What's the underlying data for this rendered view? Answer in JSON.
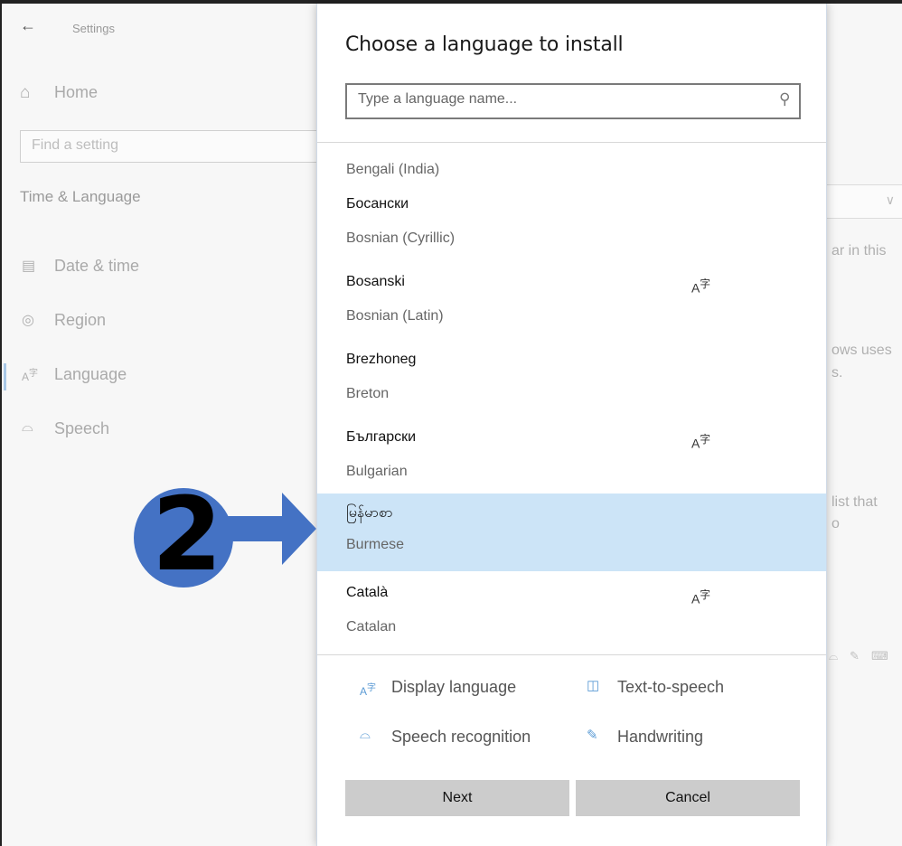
{
  "settings": {
    "title": "Settings",
    "home_label": "Home",
    "search_placeholder": "Find a setting",
    "section_title": "Time & Language",
    "nav": [
      {
        "label": "Date & time",
        "icon": "calendar-clock-icon"
      },
      {
        "label": "Region",
        "icon": "globe-icon"
      },
      {
        "label": "Language",
        "icon": "language-icon"
      },
      {
        "label": "Speech",
        "icon": "microphone-icon"
      }
    ],
    "background_fragments": [
      "ar in this",
      "ows uses",
      "s.",
      "list that",
      "o"
    ]
  },
  "dialog": {
    "title": "Choose a language to install",
    "search_placeholder": "Type a language name...",
    "languages": [
      {
        "native": "",
        "english": "Bengali (India)",
        "display_language": false
      },
      {
        "native": "Босански",
        "english": "Bosnian (Cyrillic)",
        "display_language": false
      },
      {
        "native": "Bosanski",
        "english": "Bosnian (Latin)",
        "display_language": true
      },
      {
        "native": "Brezhoneg",
        "english": "Breton",
        "display_language": false
      },
      {
        "native": "Български",
        "english": "Bulgarian",
        "display_language": true
      },
      {
        "native": "မြန်မာစာ",
        "english": "Burmese",
        "display_language": false,
        "selected": true
      },
      {
        "native": "Català",
        "english": "Catalan",
        "display_language": true
      }
    ],
    "legend": {
      "display_language": "Display language",
      "text_to_speech": "Text-to-speech",
      "speech_recognition": "Speech recognition",
      "handwriting": "Handwriting"
    },
    "next_label": "Next",
    "cancel_label": "Cancel"
  },
  "annotation": {
    "step_number": "2",
    "color": "#4472c4"
  },
  "colors": {
    "selected_row": "#cce4f7",
    "accent_icon": "#5b9bd5",
    "button_bg": "#cccccc"
  }
}
